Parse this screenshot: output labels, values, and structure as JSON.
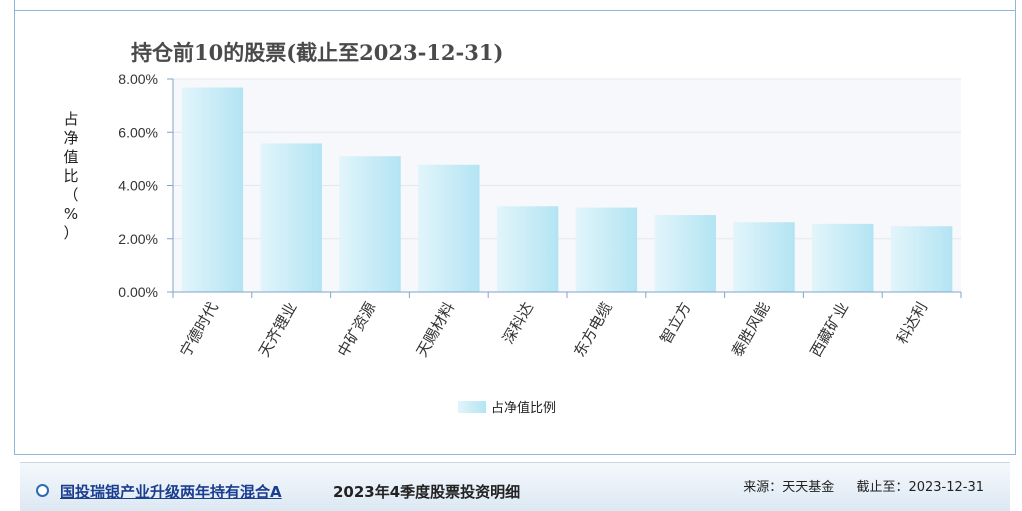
{
  "chart_data": {
    "type": "bar",
    "title": "持仓前10的股票(截止至2023-12-31)",
    "ylabel": "占净值比（%）",
    "ylabel_chars": [
      "占",
      "净",
      "值",
      "比",
      "（",
      "%",
      "）"
    ],
    "ylim": [
      0,
      8
    ],
    "y_ticks": [
      {
        "value": 0,
        "label": "0.00%"
      },
      {
        "value": 2,
        "label": "2.00%"
      },
      {
        "value": 4,
        "label": "4.00%"
      },
      {
        "value": 6,
        "label": "6.00%"
      },
      {
        "value": 8,
        "label": "8.00%"
      }
    ],
    "categories": [
      "宁德时代",
      "天齐锂业",
      "中矿资源",
      "天赐材料",
      "深科达",
      "东方电缆",
      "智立方",
      "泰胜风能",
      "西藏矿业",
      "科达利"
    ],
    "series": [
      {
        "name": "占净值比例",
        "values": [
          7.68,
          5.58,
          5.1,
          4.78,
          3.22,
          3.17,
          2.89,
          2.62,
          2.56,
          2.47
        ]
      }
    ],
    "grid": true,
    "legend_position": "bottom-center",
    "colors": {
      "bar_light": "#e2f5fb",
      "bar_dark": "#b3e4f3",
      "axis": "#7fa5c8",
      "grid": "#e3e8ee",
      "plot_bg": "#f7f8fb"
    }
  },
  "footer": {
    "fund_name": "国投瑞银产业升级两年持有混合A",
    "section_title": "2023年4季度股票投资明细",
    "source": "来源：天天基金",
    "as_of": "截止至：2023-12-31"
  }
}
